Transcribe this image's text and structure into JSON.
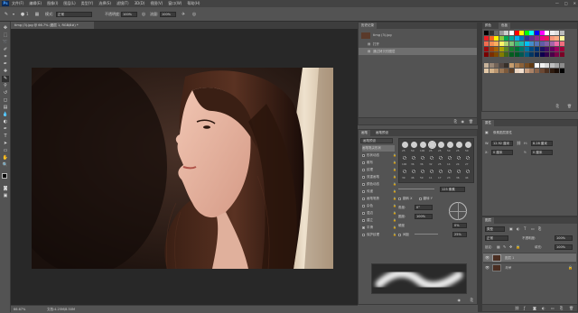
{
  "menubar": {
    "logo": "Ps",
    "items": [
      "文件(F)",
      "编辑(E)",
      "图像(I)",
      "图层(L)",
      "类型(Y)",
      "选择(S)",
      "滤镜(T)",
      "3D(D)",
      "视图(V)",
      "窗口(W)",
      "帮助(H)"
    ],
    "window_controls": [
      "—",
      "□",
      "✕"
    ]
  },
  "options": {
    "brush_size": "1",
    "mode_label": "模式:",
    "mode_value": "正常",
    "opacity_label": "不透明度:",
    "opacity_value": "100%",
    "flow_label": "流量:",
    "flow_value": "100%"
  },
  "document": {
    "tab_title": "timg (3).jpg @ 66.7% (图层 1, RGB/8#) *",
    "zoom": "66.67%",
    "doc_size": "文档:4.25M/8.50M"
  },
  "history": {
    "tabs": [
      "历史记录"
    ],
    "snapshot": "timg (3).jpg",
    "items": [
      "打开",
      "通过拷贝的图层"
    ]
  },
  "swatches": {
    "tabs": [
      "颜色",
      "色板"
    ]
  },
  "adjust": {
    "tabs": [
      "属性"
    ],
    "title": "像素图层属性",
    "w_label": "W:",
    "w_value": "12.92 厘米",
    "h_label": "H:",
    "h_value": "8.28 厘米",
    "x_label": "X:",
    "x_value": "0 厘米",
    "y_label": "Y:",
    "y_value": "0 厘米"
  },
  "brush": {
    "tabs": [
      "画笔",
      "画笔预设"
    ],
    "preset_button": "画笔预设",
    "options": [
      "画笔笔尖形状",
      "形状动态",
      "散布",
      "纹理",
      "双重画笔",
      "颜色动态",
      "传递",
      "画笔笔势",
      "杂色",
      "湿边",
      "建立",
      "平滑",
      "保护纹理"
    ],
    "size_value": "125 像素",
    "flip_x": "翻转 X",
    "flip_y": "翻转 Y",
    "angle_label": "角度:",
    "angle_value": "0°",
    "roundness_label": "圆度:",
    "roundness_value": "100%",
    "hardness_label": "硬度",
    "hardness_value": "0%",
    "spacing_label": "间距",
    "spacing_value": "25%",
    "tip_sizes": [
      "25",
      "50",
      "100",
      "25",
      "25",
      "50",
      "25",
      "50",
      "100",
      "36",
      "36",
      "32",
      "25",
      "14",
      "24",
      "27",
      "39",
      "46",
      "59",
      "11",
      "17",
      "23",
      "36",
      "44"
    ]
  },
  "layers": {
    "tabs": [
      "图层"
    ],
    "kind_label": "类型",
    "blend_mode": "正常",
    "opacity_label": "不透明度:",
    "opacity_value": "100%",
    "lock_label": "锁定:",
    "fill_label": "填充:",
    "fill_value": "100%",
    "items": [
      "图层 1",
      "背景"
    ]
  }
}
